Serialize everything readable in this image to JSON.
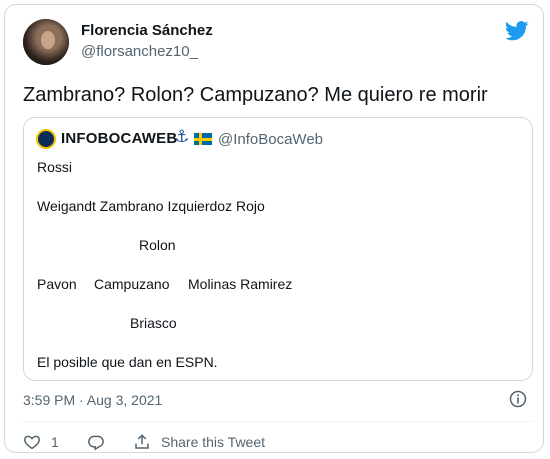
{
  "author": {
    "name": "Florencia Sánchez",
    "handle": "@florsanchez10_"
  },
  "tweet": {
    "text": "Zambrano? Rolon? Campuzano? Me quiero re morir"
  },
  "quoted": {
    "name": "INFOBOCAWEB",
    "badges": [
      "anchor-icon",
      "sweden-flag-icon"
    ],
    "handle": "@InfoBocaWeb",
    "lines": {
      "l1": "Rossi",
      "l2": "Weigandt Zambrano Izquierdoz Rojo",
      "l3": "Rolon",
      "l4a": "Pavon",
      "l4b": "Campuzano",
      "l4c": "Molinas Ramirez",
      "l5": "Briasco",
      "l6": "El posible que dan en ESPN."
    }
  },
  "meta": {
    "timestamp": "3:59 PM · Aug 3, 2021"
  },
  "actions": {
    "like_count": "1",
    "share_label": "Share this Tweet"
  },
  "colors": {
    "twitter_blue": "#1d9bf0",
    "muted": "#536471"
  }
}
